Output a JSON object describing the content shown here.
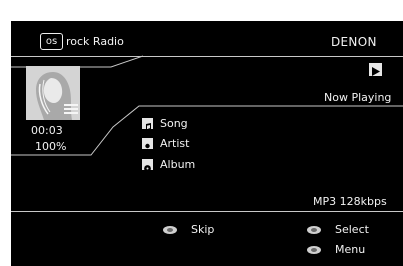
{
  "header": {
    "service_logo_text": "os",
    "station": "rock Radio",
    "brand": "DENON"
  },
  "player": {
    "status": "Now Playing",
    "play_icon": "play-icon",
    "elapsed": "00:03",
    "progress_text": "100%",
    "format": "MP3 128kbps"
  },
  "info_items": [
    {
      "icon": "music-note-icon",
      "label": "Song"
    },
    {
      "icon": "artist-icon",
      "label": "Artist"
    },
    {
      "icon": "album-icon",
      "label": "Album"
    }
  ],
  "footer": {
    "skip_label": "Skip",
    "select_label": "Select",
    "menu_label": "Menu"
  },
  "colors": {
    "background": "#000000",
    "text": "#f2f2f2",
    "lines": "#c8c8c8"
  }
}
